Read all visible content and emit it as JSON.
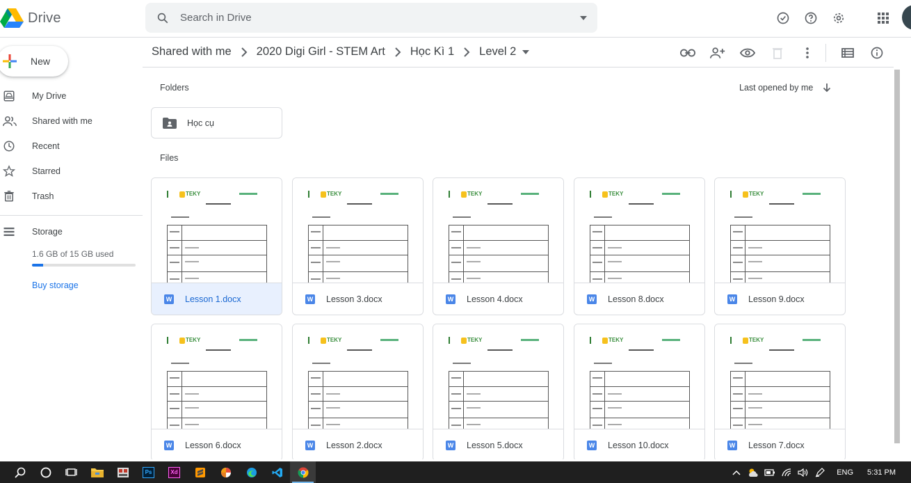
{
  "header": {
    "app_name": "Drive",
    "search_placeholder": "Search in Drive",
    "icons": [
      "offline-check-icon",
      "help-icon",
      "settings-icon",
      "apps-grid-icon",
      "account-avatar"
    ]
  },
  "sidebar": {
    "new_label": "New",
    "items": [
      {
        "label": "My Drive",
        "icon": "my-drive-icon"
      },
      {
        "label": "Shared with me",
        "icon": "shared-people-icon"
      },
      {
        "label": "Recent",
        "icon": "clock-icon"
      },
      {
        "label": "Starred",
        "icon": "star-icon"
      },
      {
        "label": "Trash",
        "icon": "trash-icon"
      }
    ],
    "storage": {
      "label": "Storage",
      "used_text": "1.6 GB of 15 GB used",
      "used_fraction": 0.107,
      "buy_label": "Buy storage"
    }
  },
  "breadcrumb": {
    "items": [
      "Shared with me",
      "2020 Digi Girl - STEM Art",
      "Học Kì 1",
      "Level 2"
    ]
  },
  "toolbar": {
    "icons": [
      "get-link-icon",
      "share-add-person-icon",
      "preview-eye-icon",
      "remove-trash-icon",
      "more-vert-icon",
      "list-view-icon",
      "details-info-icon"
    ]
  },
  "content": {
    "folders_title": "Folders",
    "sort_label": "Last opened by me",
    "folders": [
      {
        "name": "Học cụ"
      }
    ],
    "files_title": "Files",
    "files": [
      {
        "name": "Lesson 1.docx",
        "selected": true
      },
      {
        "name": "Lesson 3.docx",
        "selected": false
      },
      {
        "name": "Lesson 4.docx",
        "selected": false
      },
      {
        "name": "Lesson 8.docx",
        "selected": false
      },
      {
        "name": "Lesson 9.docx",
        "selected": false
      },
      {
        "name": "Lesson 6.docx",
        "selected": false
      },
      {
        "name": "Lesson 2.docx",
        "selected": false
      },
      {
        "name": "Lesson 5.docx",
        "selected": false
      },
      {
        "name": "Lesson 10.docx",
        "selected": false
      },
      {
        "name": "Lesson 7.docx",
        "selected": false
      }
    ],
    "file_type_badge": "W",
    "thumb_logo_text": "TEKY"
  },
  "taskbar": {
    "apps": [
      "search-icon",
      "cortana-icon",
      "task-view-icon",
      "file-explorer-icon",
      "unikey-icon",
      "photoshop-icon",
      "xd-icon",
      "sublime-icon",
      "pinwheel-icon",
      "edge-icon",
      "vscode-icon",
      "chrome-icon"
    ],
    "app_labels": {
      "photoshop": "Ps",
      "xd": "Xd"
    },
    "language": "ENG",
    "clock": "5:31 PM"
  },
  "colors": {
    "accent": "#1a73e8",
    "selected_bg": "#e8f0fe",
    "word_blue": "#4a86e8",
    "taskbar_bg": "#1f1f1f"
  }
}
